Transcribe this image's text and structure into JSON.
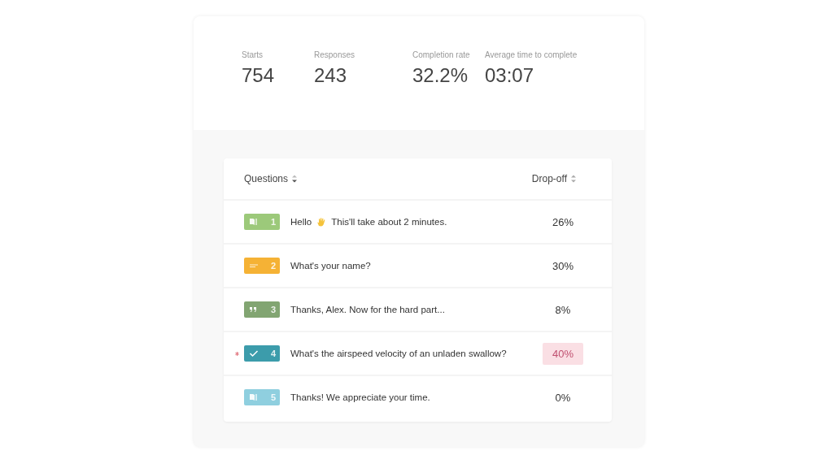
{
  "stats": [
    {
      "label": "Starts",
      "value": "754"
    },
    {
      "label": "Responses",
      "value": "243"
    },
    {
      "label": "Completion rate",
      "value": "32.2%"
    },
    {
      "label": "Average time to complete",
      "value": "03:07"
    }
  ],
  "table": {
    "columns": [
      "Questions",
      "Drop-off"
    ],
    "rows": [
      {
        "kind": "welcome",
        "color": "#9cc97a",
        "number": "1",
        "text_parts": [
          "Hello",
          "This'll take about 2 minutes."
        ],
        "dropoff": "26%",
        "highlighted": false,
        "required": false
      },
      {
        "kind": "short_text",
        "color": "#f5b235",
        "number": "2",
        "text_parts": [
          "What's your name?"
        ],
        "dropoff": "30%",
        "highlighted": false,
        "required": false
      },
      {
        "kind": "statement",
        "color": "#82a572",
        "number": "3",
        "text_parts": [
          "Thanks, Alex. Now for the hard part..."
        ],
        "dropoff": "8%",
        "highlighted": false,
        "required": false
      },
      {
        "kind": "multiple_choice",
        "color": "#3c9cab",
        "number": "4",
        "text_parts": [
          "What's the airspeed velocity of an unladen swallow?"
        ],
        "dropoff": "40%",
        "highlighted": true,
        "required": true
      },
      {
        "kind": "thank_you",
        "color": "#8fcfdf",
        "number": "5",
        "text_parts": [
          "Thanks! We appreciate your time."
        ],
        "dropoff": "0%",
        "highlighted": false,
        "required": false
      }
    ]
  }
}
